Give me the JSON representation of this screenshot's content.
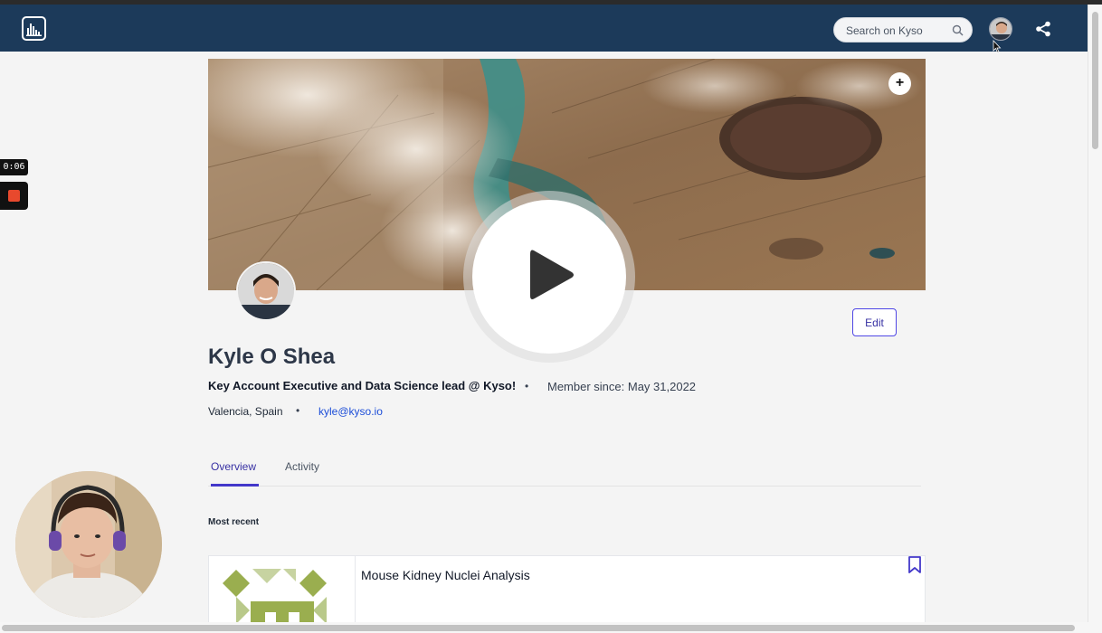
{
  "recording": {
    "timer": "0:06"
  },
  "navbar": {
    "logo_icon": "kyso-bar-chart-logo-icon",
    "search": {
      "placeholder": "Search on Kyso",
      "icon": "search-icon"
    },
    "avatar_icon": "user-avatar",
    "share_icon": "share-icon"
  },
  "profile": {
    "cover_add_icon": "plus-icon",
    "edit_label": "Edit",
    "name": "Kyle O Shea",
    "headline": "Key Account Executive and Data Science lead @ Kyso!",
    "separator": "•",
    "member_since": "Member since: May 31,2022",
    "location": "Valencia, Spain",
    "email": "kyle@kyso.io"
  },
  "tabs": [
    {
      "label": "Overview",
      "active": true
    },
    {
      "label": "Activity",
      "active": false
    }
  ],
  "section": {
    "most_recent": "Most recent"
  },
  "cards": [
    {
      "title": "Mouse Kidney Nuclei Analysis",
      "bookmark_icon": "bookmark-icon"
    }
  ],
  "video_overlay": {
    "play_icon": "play-icon"
  },
  "colors": {
    "navbar": "#1c3a5a",
    "accent": "#3730a3",
    "link": "#1d4ed8",
    "record": "#e8492d"
  }
}
